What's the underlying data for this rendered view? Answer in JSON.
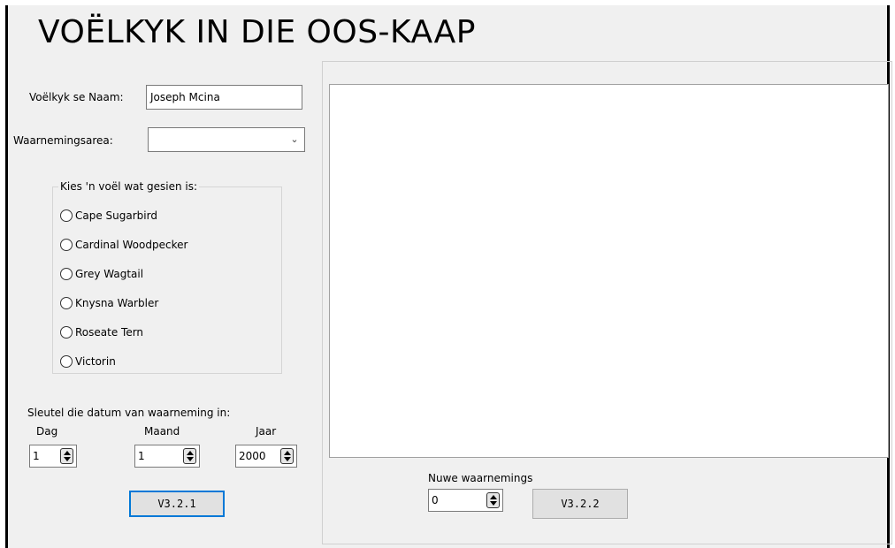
{
  "title": "VOËLKYK IN DIE OOS-KAAP",
  "name_label": "Voëlkyk se Naam:",
  "name_value": "Joseph Mcina",
  "area_label": "Waarnemingsarea:",
  "area_value": "",
  "bird_group": {
    "caption": "Kies 'n voël wat gesien is:",
    "options": [
      "Cape Sugarbird",
      "Cardinal Woodpecker",
      "Grey Wagtail",
      "Knysna Warbler",
      "Roseate Tern",
      "Victorin"
    ]
  },
  "date": {
    "label": "Sleutel die datum van waarneming in:",
    "day_label": "Dag",
    "day_value": "1",
    "month_label": "Maand",
    "month_value": "1",
    "year_label": "Jaar",
    "year_value": "2000"
  },
  "btn_left_label": "V3.2.1",
  "new_obs_label": "Nuwe waarnemings",
  "new_obs_value": "0",
  "btn_right_label": "V3.2.2",
  "icons": {
    "dropdown": "chevron-down-icon",
    "spinner": "up-down-arrows-icon",
    "radio": "radio-unchecked-icon"
  },
  "colors": {
    "form_background": "#f0f0f0",
    "focus_border": "#0078d7"
  }
}
